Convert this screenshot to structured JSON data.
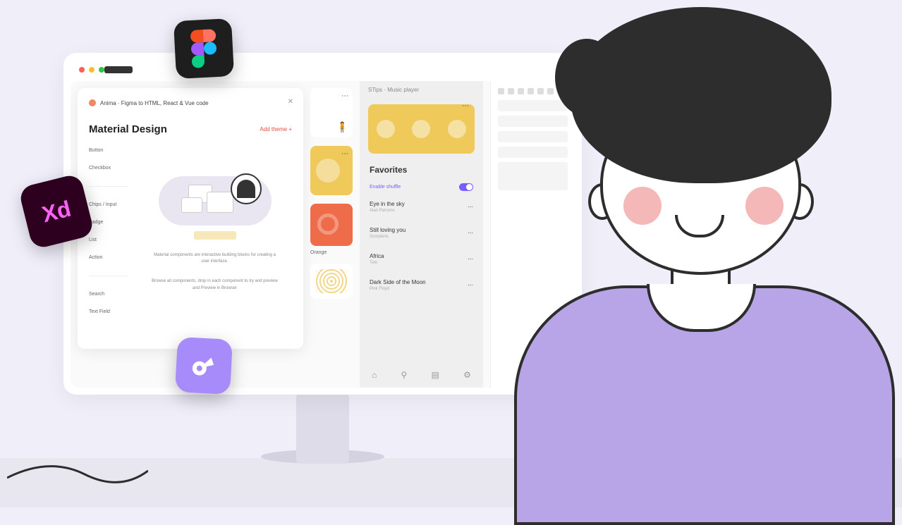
{
  "modal": {
    "header": "Anima · Figma to HTML, React & Vue code",
    "title": "Material Design",
    "add_theme": "Add theme  +",
    "side_items": [
      "Button",
      "Checkbox",
      "",
      "Chips / Input",
      "Badge",
      "List",
      "Action",
      "",
      "Search",
      "Text Field"
    ],
    "desc1": "Material components are interactive building blocks for creating a user interface.",
    "desc2": "Browse all components, drop in each component to try and preview and Preview in Browser"
  },
  "previews": {
    "label_orange": "Orange"
  },
  "player": {
    "title": "STips · Music player",
    "favorites": "Favorites",
    "enable_shuffle": "Enable shuffle",
    "songs": [
      {
        "t": "Eye in the sky",
        "a": "Alan Parsons"
      },
      {
        "t": "Still loving you",
        "a": "Scorpions"
      },
      {
        "t": "Africa",
        "a": "Toto"
      },
      {
        "t": "Dark Side of the Moon",
        "a": "Pink Floyd"
      }
    ]
  },
  "icons": {
    "xd": "Xd"
  }
}
